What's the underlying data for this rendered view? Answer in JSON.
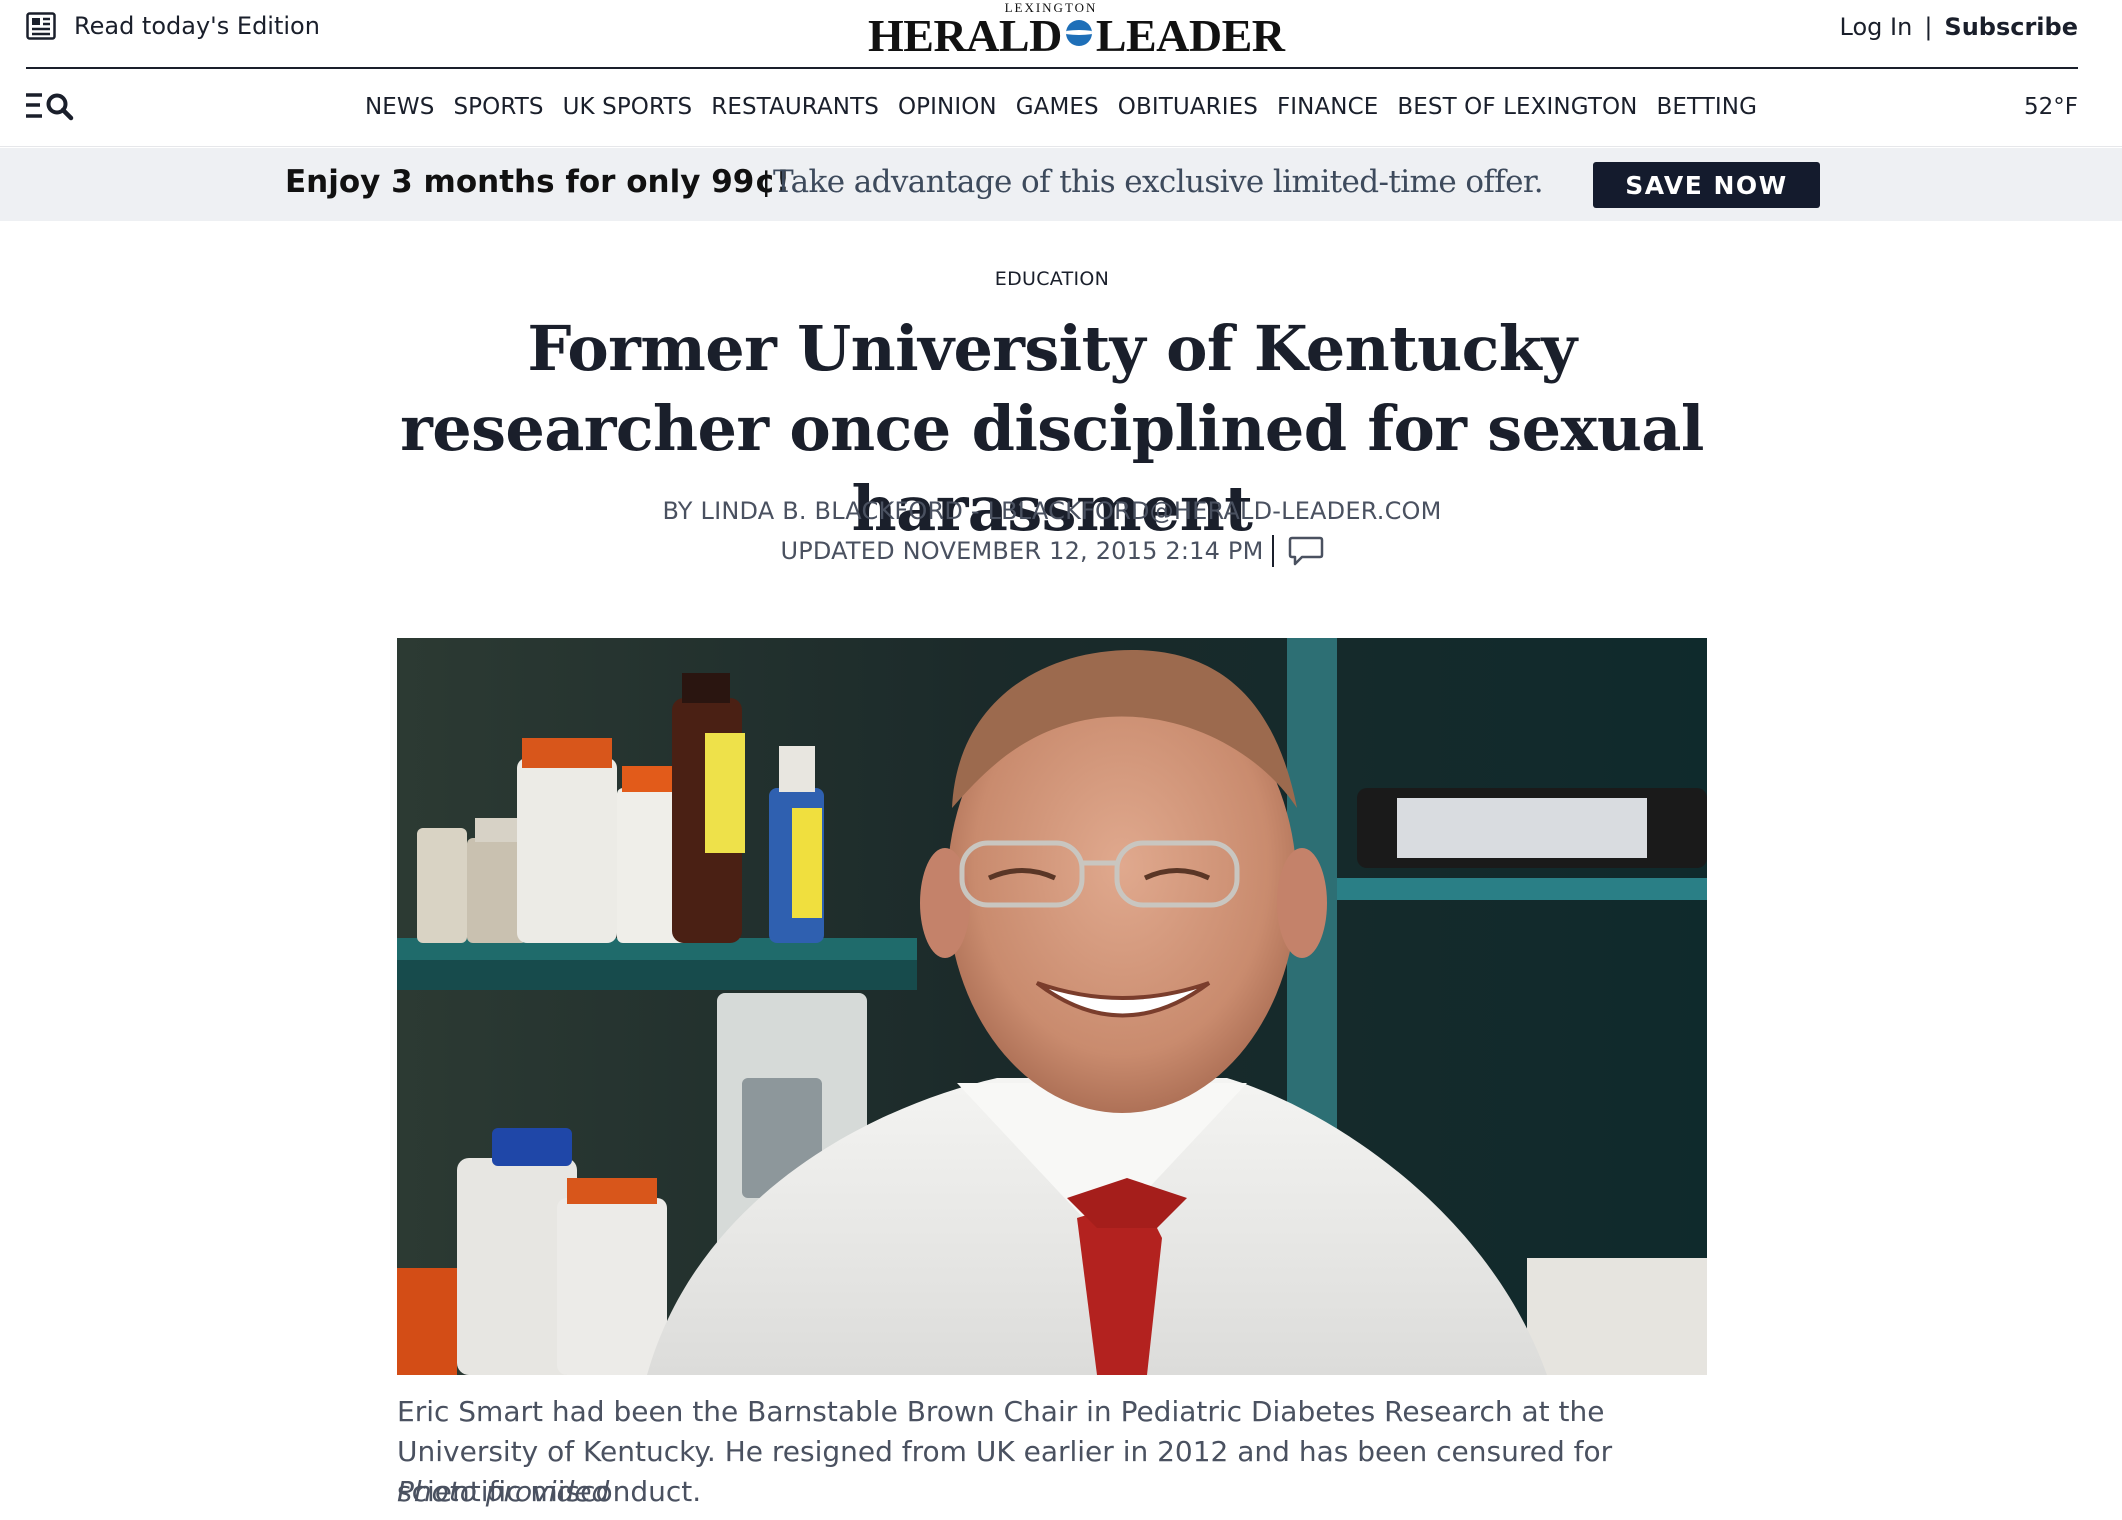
{
  "header": {
    "edition_label": "Read today's Edition",
    "logo_small": "LEXINGTON",
    "logo_left": "HERALD",
    "logo_right": "LEADER",
    "login": "Log In",
    "separator": "|",
    "subscribe": "Subscribe"
  },
  "nav": {
    "items": [
      "NEWS",
      "SPORTS",
      "UK SPORTS",
      "RESTAURANTS",
      "OPINION",
      "GAMES",
      "OBITUARIES",
      "FINANCE",
      "BEST OF LEXINGTON",
      "BETTING"
    ],
    "weather": "52°F"
  },
  "promo": {
    "lead": "Enjoy 3 months for only 99¢!",
    "text": "Take advantage of this exclusive limited-time offer.",
    "button": "SAVE NOW"
  },
  "article": {
    "section": "EDUCATION",
    "headline": "Former University of Kentucky researcher once disciplined for sexual harassment",
    "byline": "BY LINDA B. BLACKFORD - LBLACKFORD@HERALD-LEADER.COM",
    "updated": "UPDATED NOVEMBER 12, 2015 2:14 PM",
    "caption": "Eric Smart had been the Barnstable Brown Chair in Pediatric Diabetes Research at the University of Kentucky. He resigned from UK earlier in 2012 and has been censured for scientific misconduct.",
    "credit": "Photo provided"
  },
  "colors": {
    "promo_background": "#eef0f3",
    "button_background": "#141b2d",
    "logo_accent": "#1e6fb8"
  },
  "icons": {
    "edition": "newspaper-icon",
    "menu": "menu-icon",
    "search": "search-icon",
    "comment": "comment-icon"
  }
}
